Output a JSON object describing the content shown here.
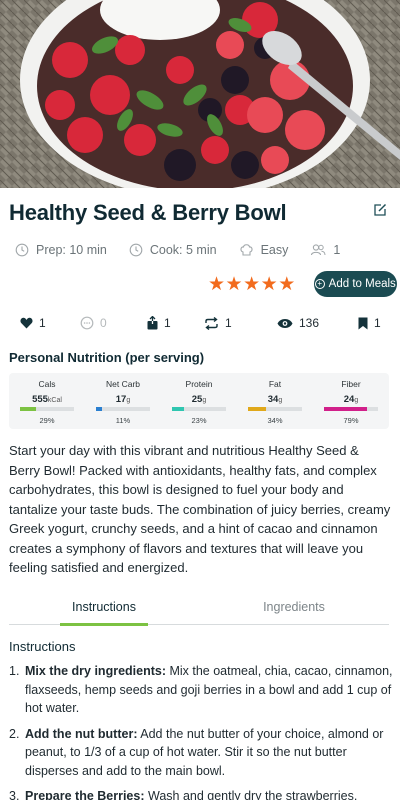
{
  "hero": {
    "image_description_icon": "berry-bowl-photo"
  },
  "recipe": {
    "title": "Healthy Seed & Berry Bowl",
    "prep": "Prep: 10 min",
    "cook": "Cook: 5 min",
    "difficulty": "Easy",
    "servings": "1",
    "rating": 5,
    "add_button": "Add to Meals"
  },
  "stats": {
    "likes": "1",
    "comments": "0",
    "shares": "1",
    "reposts": "1",
    "views": "136",
    "saves": "1"
  },
  "nutrition": {
    "title": "Personal Nutrition (per serving)",
    "items": [
      {
        "label": "Cals",
        "value": "555",
        "unit": "kCal",
        "pct": "29%",
        "fill": 0.29,
        "color": "#7cc242"
      },
      {
        "label": "Net Carb",
        "value": "17",
        "unit": "g",
        "pct": "11%",
        "fill": 0.11,
        "color": "#2a7fd0"
      },
      {
        "label": "Protein",
        "value": "25",
        "unit": "g",
        "pct": "23%",
        "fill": 0.23,
        "color": "#2fc6b0"
      },
      {
        "label": "Fat",
        "value": "34",
        "unit": "g",
        "pct": "34%",
        "fill": 0.34,
        "color": "#e0a81a"
      },
      {
        "label": "Fiber",
        "value": "24",
        "unit": "g",
        "pct": "79%",
        "fill": 0.79,
        "color": "#d1208a"
      }
    ]
  },
  "description": "Start your day with this vibrant and nutritious Healthy Seed & Berry Bowl! Packed with antioxidants, healthy fats, and complex carbohydrates, this bowl is designed to fuel your body and tantalize your taste buds. The combination of juicy berries, creamy Greek yogurt, crunchy seeds, and a hint of cacao and cinnamon creates a symphony of flavors and textures that will leave you feeling satisfied and energized.",
  "tabs": {
    "instructions": "Instructions",
    "ingredients": "Ingredients"
  },
  "instructions": {
    "heading": "Instructions",
    "steps": [
      {
        "num": "1.",
        "title": "Mix the dry ingredients:",
        "text": " Mix the oatmeal, chia, cacao, cinnamon, flaxseeds, hemp seeds and goji berries in a bowl and add 1 cup of hot water."
      },
      {
        "num": "2.",
        "title": "Add the nut butter:",
        "text": " Add the nut butter of your choice, almond or peanut, to 1/3 of a cup of hot water. Stir it so the nut butter disperses and add to the main bowl."
      },
      {
        "num": "3.",
        "title": "Prepare the Berries:",
        "text": " Wash and gently dry the strawberries,"
      }
    ]
  }
}
